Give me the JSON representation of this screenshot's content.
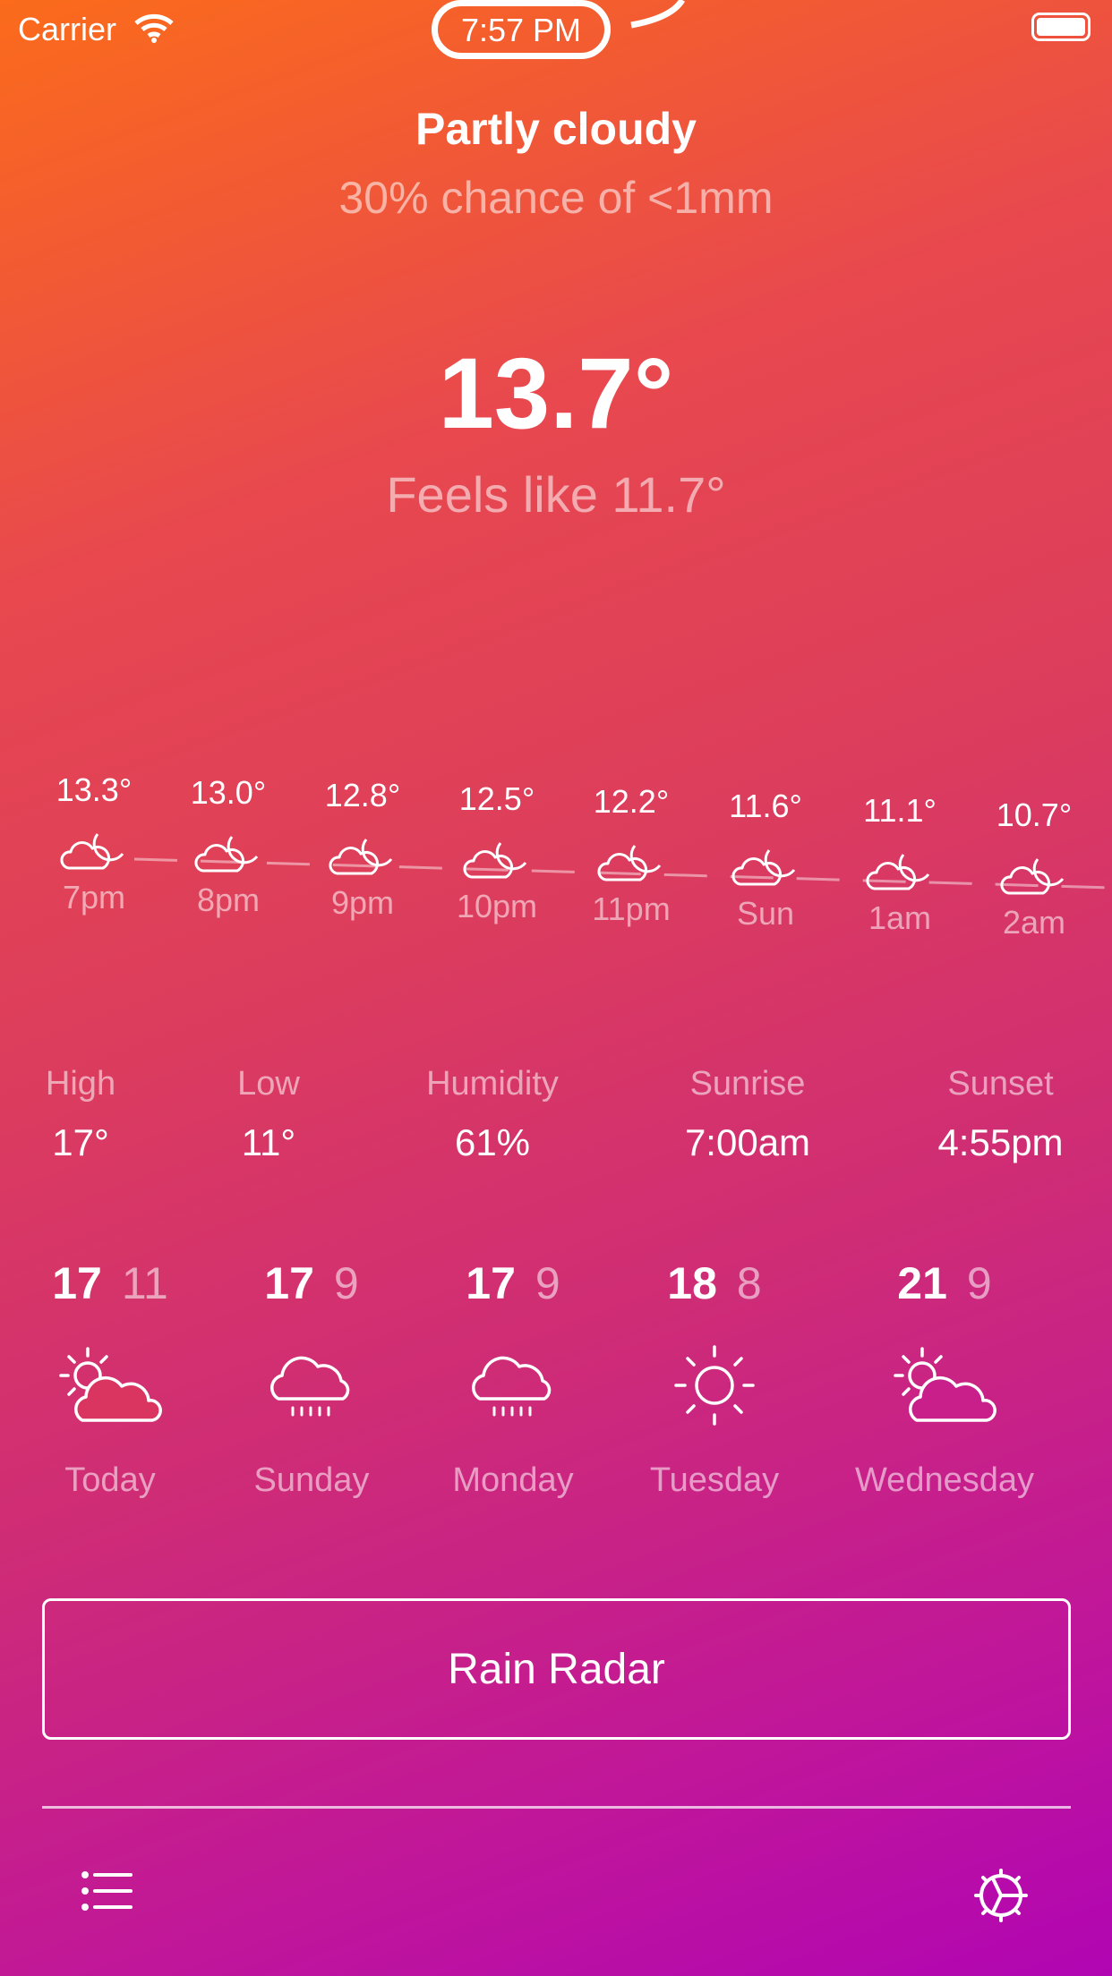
{
  "status_bar": {
    "carrier": "Carrier",
    "time": "7:57 PM"
  },
  "current": {
    "condition": "Partly cloudy",
    "chance": "30% chance of <1mm",
    "temperature": "13.7°",
    "feels_like": "Feels like 11.7°"
  },
  "hourly": [
    {
      "temp": "13.3°",
      "label": "7pm",
      "icon": "partly-cloudy-night-icon"
    },
    {
      "temp": "13.0°",
      "label": "8pm",
      "icon": "partly-cloudy-night-icon"
    },
    {
      "temp": "12.8°",
      "label": "9pm",
      "icon": "partly-cloudy-night-icon"
    },
    {
      "temp": "12.5°",
      "label": "10pm",
      "icon": "partly-cloudy-night-icon"
    },
    {
      "temp": "12.2°",
      "label": "11pm",
      "icon": "partly-cloudy-night-icon"
    },
    {
      "temp": "11.6°",
      "label": "Sun",
      "icon": "partly-cloudy-night-icon"
    },
    {
      "temp": "11.1°",
      "label": "1am",
      "icon": "partly-cloudy-night-icon"
    },
    {
      "temp": "10.7°",
      "label": "2am",
      "icon": "partly-cloudy-night-icon"
    }
  ],
  "stats": [
    {
      "label": "High",
      "value": "17°"
    },
    {
      "label": "Low",
      "value": "11°"
    },
    {
      "label": "Humidity",
      "value": "61%"
    },
    {
      "label": "Sunrise",
      "value": "7:00am"
    },
    {
      "label": "Sunset",
      "value": "4:55pm"
    }
  ],
  "daily": [
    {
      "high": "17",
      "low": "11",
      "name": "Today",
      "icon": "partly-cloudy-day-icon"
    },
    {
      "high": "17",
      "low": "9",
      "name": "Sunday",
      "icon": "rain-icon"
    },
    {
      "high": "17",
      "low": "9",
      "name": "Monday",
      "icon": "rain-icon"
    },
    {
      "high": "18",
      "low": "8",
      "name": "Tuesday",
      "icon": "sun-icon"
    },
    {
      "high": "21",
      "low": "9",
      "name": "Wednesday",
      "icon": "partly-cloudy-day-icon"
    }
  ],
  "rain_radar_label": "Rain Radar",
  "toolbar": {
    "left_icon": "list-icon",
    "right_icon": "settings-icon"
  },
  "colors": {
    "gradient_top": "#fb6b1b",
    "gradient_bottom": "#b105b3",
    "text": "#ffffff"
  }
}
